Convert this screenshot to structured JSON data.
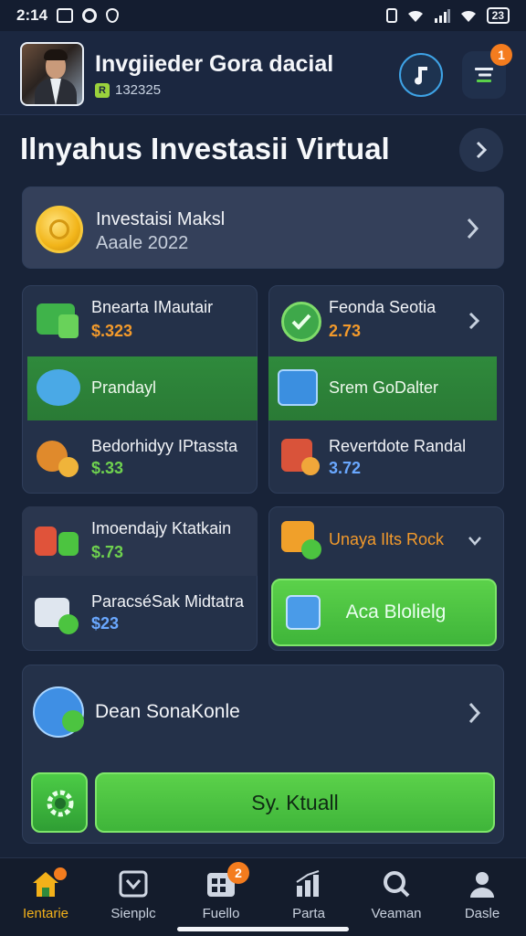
{
  "status_bar": {
    "time": "2:14",
    "battery": "23"
  },
  "header": {
    "user_name": "Invgiieder Gora dacial",
    "user_id": "132325",
    "notification_count": "1"
  },
  "section": {
    "title": "Ilnyahus Investasii Virtual"
  },
  "feature_card": {
    "title": "Investaisi Maksl",
    "subtitle": "Aaale 2022"
  },
  "left_group_1": {
    "tile1": {
      "name": "Bnearta IMautair",
      "value": "$.323"
    },
    "band": {
      "label": "Prandayl"
    },
    "tile2": {
      "name": "Bedorhidyy IPtassta",
      "value": "$.33"
    }
  },
  "right_group_1": {
    "tile1": {
      "name": "Feonda Seotia",
      "value": "2.73"
    },
    "band": {
      "label": "Srem GoDalter"
    },
    "tile2": {
      "name": "Revertdote Randal",
      "value": "3.72"
    }
  },
  "left_group_2": {
    "tile1": {
      "name": "Imoendajy Ktatkain",
      "value": "$.73"
    },
    "tile2": {
      "name": "ParacséSak Midtatra",
      "value": "$23"
    }
  },
  "right_group_2": {
    "title": "Unaya Ilts Rock",
    "button": "Aca Blolielg"
  },
  "bottom_card": {
    "title": "Dean SonaKonle",
    "button": "Sy. Ktuall"
  },
  "tabs": [
    {
      "label": "Ientarie"
    },
    {
      "label": "Sienplc"
    },
    {
      "label": "Fuello",
      "badge": "2"
    },
    {
      "label": "Parta"
    },
    {
      "label": "Veaman"
    },
    {
      "label": "Dasle"
    }
  ],
  "colors": {
    "accent_green": "#4cc440",
    "accent_orange": "#f39a2b",
    "background": "#182338"
  }
}
